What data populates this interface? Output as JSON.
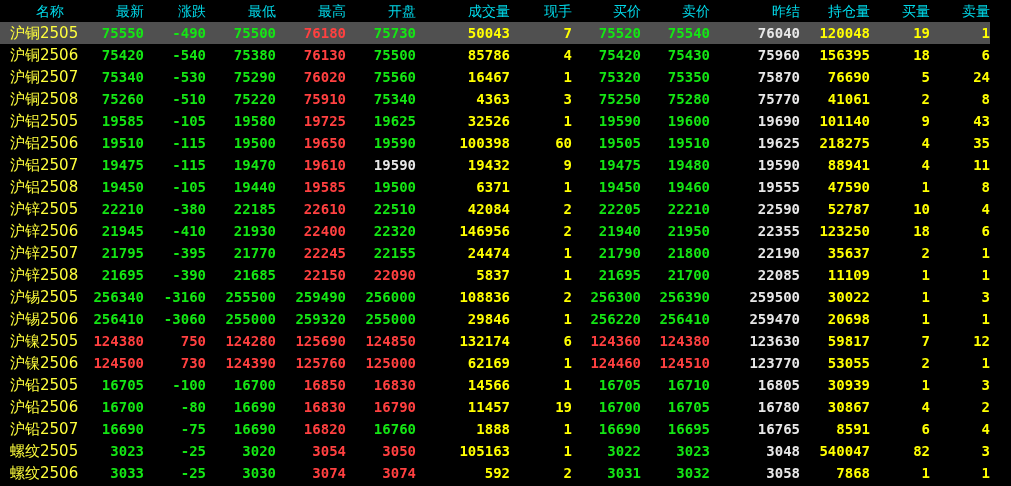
{
  "columns": [
    "名称",
    "最新",
    "涨跌",
    "最低",
    "最高",
    "开盘",
    "成交量",
    "现手",
    "买价",
    "卖价",
    "昨结",
    "持仓量",
    "买量",
    "卖量"
  ],
  "rows": [
    {
      "selected": true,
      "cells": [
        {
          "text": "沪铜2505",
          "kind": "name"
        },
        {
          "text": "75550",
          "kind": "down"
        },
        {
          "text": "-490",
          "kind": "down"
        },
        {
          "text": "75500",
          "kind": "down"
        },
        {
          "text": "76180",
          "kind": "up"
        },
        {
          "text": "75730",
          "kind": "down"
        },
        {
          "text": "50043",
          "kind": "volume"
        },
        {
          "text": "7",
          "kind": "volume"
        },
        {
          "text": "75520",
          "kind": "down"
        },
        {
          "text": "75540",
          "kind": "down"
        },
        {
          "text": "76040",
          "kind": "flat"
        },
        {
          "text": "120048",
          "kind": "volume"
        },
        {
          "text": "19",
          "kind": "volume"
        },
        {
          "text": "1",
          "kind": "volume"
        }
      ]
    },
    {
      "selected": false,
      "cells": [
        {
          "text": "沪铜2506",
          "kind": "name"
        },
        {
          "text": "75420",
          "kind": "down"
        },
        {
          "text": "-540",
          "kind": "down"
        },
        {
          "text": "75380",
          "kind": "down"
        },
        {
          "text": "76130",
          "kind": "up"
        },
        {
          "text": "75500",
          "kind": "down"
        },
        {
          "text": "85786",
          "kind": "volume"
        },
        {
          "text": "4",
          "kind": "volume"
        },
        {
          "text": "75420",
          "kind": "down"
        },
        {
          "text": "75430",
          "kind": "down"
        },
        {
          "text": "75960",
          "kind": "flat"
        },
        {
          "text": "156395",
          "kind": "volume"
        },
        {
          "text": "18",
          "kind": "volume"
        },
        {
          "text": "6",
          "kind": "volume"
        }
      ]
    },
    {
      "selected": false,
      "cells": [
        {
          "text": "沪铜2507",
          "kind": "name"
        },
        {
          "text": "75340",
          "kind": "down"
        },
        {
          "text": "-530",
          "kind": "down"
        },
        {
          "text": "75290",
          "kind": "down"
        },
        {
          "text": "76020",
          "kind": "up"
        },
        {
          "text": "75560",
          "kind": "down"
        },
        {
          "text": "16467",
          "kind": "volume"
        },
        {
          "text": "1",
          "kind": "volume"
        },
        {
          "text": "75320",
          "kind": "down"
        },
        {
          "text": "75350",
          "kind": "down"
        },
        {
          "text": "75870",
          "kind": "flat"
        },
        {
          "text": "76690",
          "kind": "volume"
        },
        {
          "text": "5",
          "kind": "volume"
        },
        {
          "text": "24",
          "kind": "volume"
        }
      ]
    },
    {
      "selected": false,
      "cells": [
        {
          "text": "沪铜2508",
          "kind": "name"
        },
        {
          "text": "75260",
          "kind": "down"
        },
        {
          "text": "-510",
          "kind": "down"
        },
        {
          "text": "75220",
          "kind": "down"
        },
        {
          "text": "75910",
          "kind": "up"
        },
        {
          "text": "75340",
          "kind": "down"
        },
        {
          "text": "4363",
          "kind": "volume"
        },
        {
          "text": "3",
          "kind": "volume"
        },
        {
          "text": "75250",
          "kind": "down"
        },
        {
          "text": "75280",
          "kind": "down"
        },
        {
          "text": "75770",
          "kind": "flat"
        },
        {
          "text": "41061",
          "kind": "volume"
        },
        {
          "text": "2",
          "kind": "volume"
        },
        {
          "text": "8",
          "kind": "volume"
        }
      ]
    },
    {
      "selected": false,
      "cells": [
        {
          "text": "沪铝2505",
          "kind": "name"
        },
        {
          "text": "19585",
          "kind": "down"
        },
        {
          "text": "-105",
          "kind": "down"
        },
        {
          "text": "19580",
          "kind": "down"
        },
        {
          "text": "19725",
          "kind": "up"
        },
        {
          "text": "19625",
          "kind": "down"
        },
        {
          "text": "32526",
          "kind": "volume"
        },
        {
          "text": "1",
          "kind": "volume"
        },
        {
          "text": "19590",
          "kind": "down"
        },
        {
          "text": "19600",
          "kind": "down"
        },
        {
          "text": "19690",
          "kind": "flat"
        },
        {
          "text": "101140",
          "kind": "volume"
        },
        {
          "text": "9",
          "kind": "volume"
        },
        {
          "text": "43",
          "kind": "volume"
        }
      ]
    },
    {
      "selected": false,
      "cells": [
        {
          "text": "沪铝2506",
          "kind": "name"
        },
        {
          "text": "19510",
          "kind": "down"
        },
        {
          "text": "-115",
          "kind": "down"
        },
        {
          "text": "19500",
          "kind": "down"
        },
        {
          "text": "19650",
          "kind": "up"
        },
        {
          "text": "19590",
          "kind": "down"
        },
        {
          "text": "100398",
          "kind": "volume"
        },
        {
          "text": "60",
          "kind": "volume"
        },
        {
          "text": "19505",
          "kind": "down"
        },
        {
          "text": "19510",
          "kind": "down"
        },
        {
          "text": "19625",
          "kind": "flat"
        },
        {
          "text": "218275",
          "kind": "volume"
        },
        {
          "text": "4",
          "kind": "volume"
        },
        {
          "text": "35",
          "kind": "volume"
        }
      ]
    },
    {
      "selected": false,
      "cells": [
        {
          "text": "沪铝2507",
          "kind": "name"
        },
        {
          "text": "19475",
          "kind": "down"
        },
        {
          "text": "-115",
          "kind": "down"
        },
        {
          "text": "19470",
          "kind": "down"
        },
        {
          "text": "19610",
          "kind": "up"
        },
        {
          "text": "19590",
          "kind": "flat"
        },
        {
          "text": "19432",
          "kind": "volume"
        },
        {
          "text": "9",
          "kind": "volume"
        },
        {
          "text": "19475",
          "kind": "down"
        },
        {
          "text": "19480",
          "kind": "down"
        },
        {
          "text": "19590",
          "kind": "flat"
        },
        {
          "text": "88941",
          "kind": "volume"
        },
        {
          "text": "4",
          "kind": "volume"
        },
        {
          "text": "11",
          "kind": "volume"
        }
      ]
    },
    {
      "selected": false,
      "cells": [
        {
          "text": "沪铝2508",
          "kind": "name"
        },
        {
          "text": "19450",
          "kind": "down"
        },
        {
          "text": "-105",
          "kind": "down"
        },
        {
          "text": "19440",
          "kind": "down"
        },
        {
          "text": "19585",
          "kind": "up"
        },
        {
          "text": "19500",
          "kind": "down"
        },
        {
          "text": "6371",
          "kind": "volume"
        },
        {
          "text": "1",
          "kind": "volume"
        },
        {
          "text": "19450",
          "kind": "down"
        },
        {
          "text": "19460",
          "kind": "down"
        },
        {
          "text": "19555",
          "kind": "flat"
        },
        {
          "text": "47590",
          "kind": "volume"
        },
        {
          "text": "1",
          "kind": "volume"
        },
        {
          "text": "8",
          "kind": "volume"
        }
      ]
    },
    {
      "selected": false,
      "cells": [
        {
          "text": "沪锌2505",
          "kind": "name"
        },
        {
          "text": "22210",
          "kind": "down"
        },
        {
          "text": "-380",
          "kind": "down"
        },
        {
          "text": "22185",
          "kind": "down"
        },
        {
          "text": "22610",
          "kind": "up"
        },
        {
          "text": "22510",
          "kind": "down"
        },
        {
          "text": "42084",
          "kind": "volume"
        },
        {
          "text": "2",
          "kind": "volume"
        },
        {
          "text": "22205",
          "kind": "down"
        },
        {
          "text": "22210",
          "kind": "down"
        },
        {
          "text": "22590",
          "kind": "flat"
        },
        {
          "text": "52787",
          "kind": "volume"
        },
        {
          "text": "10",
          "kind": "volume"
        },
        {
          "text": "4",
          "kind": "volume"
        }
      ]
    },
    {
      "selected": false,
      "cells": [
        {
          "text": "沪锌2506",
          "kind": "name"
        },
        {
          "text": "21945",
          "kind": "down"
        },
        {
          "text": "-410",
          "kind": "down"
        },
        {
          "text": "21930",
          "kind": "down"
        },
        {
          "text": "22400",
          "kind": "up"
        },
        {
          "text": "22320",
          "kind": "down"
        },
        {
          "text": "146956",
          "kind": "volume"
        },
        {
          "text": "2",
          "kind": "volume"
        },
        {
          "text": "21940",
          "kind": "down"
        },
        {
          "text": "21950",
          "kind": "down"
        },
        {
          "text": "22355",
          "kind": "flat"
        },
        {
          "text": "123250",
          "kind": "volume"
        },
        {
          "text": "18",
          "kind": "volume"
        },
        {
          "text": "6",
          "kind": "volume"
        }
      ]
    },
    {
      "selected": false,
      "cells": [
        {
          "text": "沪锌2507",
          "kind": "name"
        },
        {
          "text": "21795",
          "kind": "down"
        },
        {
          "text": "-395",
          "kind": "down"
        },
        {
          "text": "21770",
          "kind": "down"
        },
        {
          "text": "22245",
          "kind": "up"
        },
        {
          "text": "22155",
          "kind": "down"
        },
        {
          "text": "24474",
          "kind": "volume"
        },
        {
          "text": "1",
          "kind": "volume"
        },
        {
          "text": "21790",
          "kind": "down"
        },
        {
          "text": "21800",
          "kind": "down"
        },
        {
          "text": "22190",
          "kind": "flat"
        },
        {
          "text": "35637",
          "kind": "volume"
        },
        {
          "text": "2",
          "kind": "volume"
        },
        {
          "text": "1",
          "kind": "volume"
        }
      ]
    },
    {
      "selected": false,
      "cells": [
        {
          "text": "沪锌2508",
          "kind": "name"
        },
        {
          "text": "21695",
          "kind": "down"
        },
        {
          "text": "-390",
          "kind": "down"
        },
        {
          "text": "21685",
          "kind": "down"
        },
        {
          "text": "22150",
          "kind": "up"
        },
        {
          "text": "22090",
          "kind": "up"
        },
        {
          "text": "5837",
          "kind": "volume"
        },
        {
          "text": "1",
          "kind": "volume"
        },
        {
          "text": "21695",
          "kind": "down"
        },
        {
          "text": "21700",
          "kind": "down"
        },
        {
          "text": "22085",
          "kind": "flat"
        },
        {
          "text": "11109",
          "kind": "volume"
        },
        {
          "text": "1",
          "kind": "volume"
        },
        {
          "text": "1",
          "kind": "volume"
        }
      ]
    },
    {
      "selected": false,
      "cells": [
        {
          "text": "沪锡2505",
          "kind": "name"
        },
        {
          "text": "256340",
          "kind": "down"
        },
        {
          "text": "-3160",
          "kind": "down"
        },
        {
          "text": "255500",
          "kind": "down"
        },
        {
          "text": "259490",
          "kind": "down"
        },
        {
          "text": "256000",
          "kind": "down"
        },
        {
          "text": "108836",
          "kind": "volume"
        },
        {
          "text": "2",
          "kind": "volume"
        },
        {
          "text": "256300",
          "kind": "down"
        },
        {
          "text": "256390",
          "kind": "down"
        },
        {
          "text": "259500",
          "kind": "flat"
        },
        {
          "text": "30022",
          "kind": "volume"
        },
        {
          "text": "1",
          "kind": "volume"
        },
        {
          "text": "3",
          "kind": "volume"
        }
      ]
    },
    {
      "selected": false,
      "cells": [
        {
          "text": "沪锡2506",
          "kind": "name"
        },
        {
          "text": "256410",
          "kind": "down"
        },
        {
          "text": "-3060",
          "kind": "down"
        },
        {
          "text": "255000",
          "kind": "down"
        },
        {
          "text": "259320",
          "kind": "down"
        },
        {
          "text": "255000",
          "kind": "down"
        },
        {
          "text": "29846",
          "kind": "volume"
        },
        {
          "text": "1",
          "kind": "volume"
        },
        {
          "text": "256220",
          "kind": "down"
        },
        {
          "text": "256410",
          "kind": "down"
        },
        {
          "text": "259470",
          "kind": "flat"
        },
        {
          "text": "20698",
          "kind": "volume"
        },
        {
          "text": "1",
          "kind": "volume"
        },
        {
          "text": "1",
          "kind": "volume"
        }
      ]
    },
    {
      "selected": false,
      "cells": [
        {
          "text": "沪镍2505",
          "kind": "name"
        },
        {
          "text": "124380",
          "kind": "up"
        },
        {
          "text": "750",
          "kind": "up"
        },
        {
          "text": "124280",
          "kind": "up"
        },
        {
          "text": "125690",
          "kind": "up"
        },
        {
          "text": "124850",
          "kind": "up"
        },
        {
          "text": "132174",
          "kind": "volume"
        },
        {
          "text": "6",
          "kind": "volume"
        },
        {
          "text": "124360",
          "kind": "up"
        },
        {
          "text": "124380",
          "kind": "up"
        },
        {
          "text": "123630",
          "kind": "flat"
        },
        {
          "text": "59817",
          "kind": "volume"
        },
        {
          "text": "7",
          "kind": "volume"
        },
        {
          "text": "12",
          "kind": "volume"
        }
      ]
    },
    {
      "selected": false,
      "cells": [
        {
          "text": "沪镍2506",
          "kind": "name"
        },
        {
          "text": "124500",
          "kind": "up"
        },
        {
          "text": "730",
          "kind": "up"
        },
        {
          "text": "124390",
          "kind": "up"
        },
        {
          "text": "125760",
          "kind": "up"
        },
        {
          "text": "125000",
          "kind": "up"
        },
        {
          "text": "62169",
          "kind": "volume"
        },
        {
          "text": "1",
          "kind": "volume"
        },
        {
          "text": "124460",
          "kind": "up"
        },
        {
          "text": "124510",
          "kind": "up"
        },
        {
          "text": "123770",
          "kind": "flat"
        },
        {
          "text": "53055",
          "kind": "volume"
        },
        {
          "text": "2",
          "kind": "volume"
        },
        {
          "text": "1",
          "kind": "volume"
        }
      ]
    },
    {
      "selected": false,
      "cells": [
        {
          "text": "沪铅2505",
          "kind": "name"
        },
        {
          "text": "16705",
          "kind": "down"
        },
        {
          "text": "-100",
          "kind": "down"
        },
        {
          "text": "16700",
          "kind": "down"
        },
        {
          "text": "16850",
          "kind": "up"
        },
        {
          "text": "16830",
          "kind": "up"
        },
        {
          "text": "14566",
          "kind": "volume"
        },
        {
          "text": "1",
          "kind": "volume"
        },
        {
          "text": "16705",
          "kind": "down"
        },
        {
          "text": "16710",
          "kind": "down"
        },
        {
          "text": "16805",
          "kind": "flat"
        },
        {
          "text": "30939",
          "kind": "volume"
        },
        {
          "text": "1",
          "kind": "volume"
        },
        {
          "text": "3",
          "kind": "volume"
        }
      ]
    },
    {
      "selected": false,
      "cells": [
        {
          "text": "沪铅2506",
          "kind": "name"
        },
        {
          "text": "16700",
          "kind": "down"
        },
        {
          "text": "-80",
          "kind": "down"
        },
        {
          "text": "16690",
          "kind": "down"
        },
        {
          "text": "16830",
          "kind": "up"
        },
        {
          "text": "16790",
          "kind": "up"
        },
        {
          "text": "11457",
          "kind": "volume"
        },
        {
          "text": "19",
          "kind": "volume"
        },
        {
          "text": "16700",
          "kind": "down"
        },
        {
          "text": "16705",
          "kind": "down"
        },
        {
          "text": "16780",
          "kind": "flat"
        },
        {
          "text": "30867",
          "kind": "volume"
        },
        {
          "text": "4",
          "kind": "volume"
        },
        {
          "text": "2",
          "kind": "volume"
        }
      ]
    },
    {
      "selected": false,
      "cells": [
        {
          "text": "沪铅2507",
          "kind": "name"
        },
        {
          "text": "16690",
          "kind": "down"
        },
        {
          "text": "-75",
          "kind": "down"
        },
        {
          "text": "16690",
          "kind": "down"
        },
        {
          "text": "16820",
          "kind": "up"
        },
        {
          "text": "16760",
          "kind": "down"
        },
        {
          "text": "1888",
          "kind": "volume"
        },
        {
          "text": "1",
          "kind": "volume"
        },
        {
          "text": "16690",
          "kind": "down"
        },
        {
          "text": "16695",
          "kind": "down"
        },
        {
          "text": "16765",
          "kind": "flat"
        },
        {
          "text": "8591",
          "kind": "volume"
        },
        {
          "text": "6",
          "kind": "volume"
        },
        {
          "text": "4",
          "kind": "volume"
        }
      ]
    },
    {
      "selected": false,
      "cells": [
        {
          "text": "螺纹2505",
          "kind": "name"
        },
        {
          "text": "3023",
          "kind": "down"
        },
        {
          "text": "-25",
          "kind": "down"
        },
        {
          "text": "3020",
          "kind": "down"
        },
        {
          "text": "3054",
          "kind": "up"
        },
        {
          "text": "3050",
          "kind": "up"
        },
        {
          "text": "105163",
          "kind": "volume"
        },
        {
          "text": "1",
          "kind": "volume"
        },
        {
          "text": "3022",
          "kind": "down"
        },
        {
          "text": "3023",
          "kind": "down"
        },
        {
          "text": "3048",
          "kind": "flat"
        },
        {
          "text": "540047",
          "kind": "volume"
        },
        {
          "text": "82",
          "kind": "volume"
        },
        {
          "text": "3",
          "kind": "volume"
        }
      ]
    },
    {
      "selected": false,
      "cells": [
        {
          "text": "螺纹2506",
          "kind": "name"
        },
        {
          "text": "3033",
          "kind": "down"
        },
        {
          "text": "-25",
          "kind": "down"
        },
        {
          "text": "3030",
          "kind": "down"
        },
        {
          "text": "3074",
          "kind": "up"
        },
        {
          "text": "3074",
          "kind": "up"
        },
        {
          "text": "592",
          "kind": "volume"
        },
        {
          "text": "2",
          "kind": "volume"
        },
        {
          "text": "3031",
          "kind": "down"
        },
        {
          "text": "3032",
          "kind": "down"
        },
        {
          "text": "3058",
          "kind": "flat"
        },
        {
          "text": "7868",
          "kind": "volume"
        },
        {
          "text": "1",
          "kind": "volume"
        },
        {
          "text": "1",
          "kind": "volume"
        }
      ]
    }
  ]
}
